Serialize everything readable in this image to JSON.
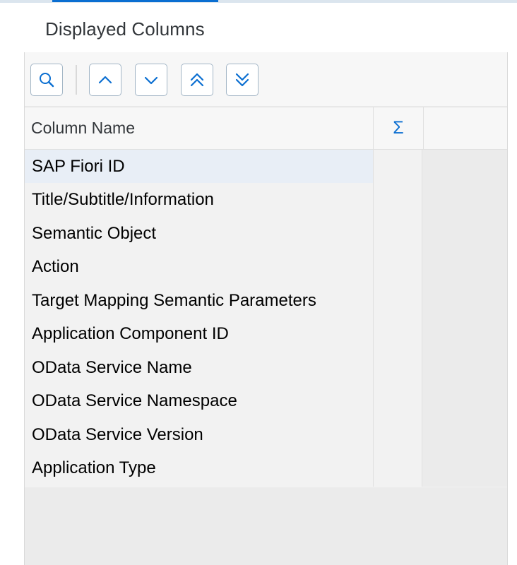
{
  "section": {
    "title": "Displayed Columns"
  },
  "toolbar": {
    "buttons": [
      {
        "name": "search-button",
        "icon": "search-icon"
      },
      {
        "name": "move-up-button",
        "icon": "chevron-up-icon"
      },
      {
        "name": "move-down-button",
        "icon": "chevron-down-icon"
      },
      {
        "name": "move-to-top-button",
        "icon": "double-chevron-up-icon"
      },
      {
        "name": "move-to-bottom-button",
        "icon": "double-chevron-down-icon"
      }
    ]
  },
  "table": {
    "header": {
      "column_name": "Column Name",
      "sigma": "Σ"
    },
    "rows": [
      "SAP Fiori ID",
      "Title/Subtitle/Information",
      "Semantic Object",
      "Action",
      "Target Mapping Semantic Parameters",
      "Application Component ID",
      "OData Service Name",
      "OData Service Namespace",
      "OData Service Version",
      "Application Type"
    ],
    "selected_row": 0
  },
  "colors": {
    "accent": "#0a6ed1",
    "button_border": "#a3b6c6",
    "selected_row": "#e8eef6"
  }
}
